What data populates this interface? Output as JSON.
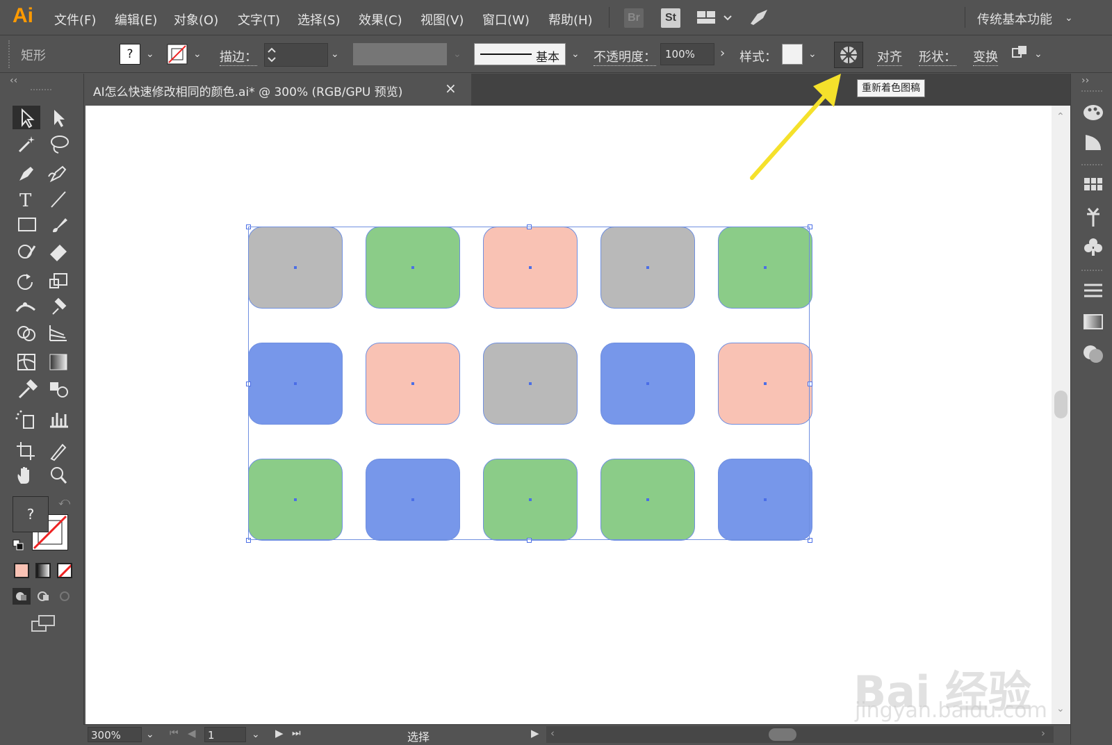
{
  "app": {
    "logo": "Ai"
  },
  "menu": [
    "文件(F)",
    "编辑(E)",
    "对象(O)",
    "文字(T)",
    "选择(S)",
    "效果(C)",
    "视图(V)",
    "窗口(W)",
    "帮助(H)"
  ],
  "menubar_right": {
    "br_label": "Br",
    "st_label": "St",
    "workspace": "传统基本功能"
  },
  "controlbar": {
    "object_type": "矩形",
    "fill_swatch": "?",
    "stroke_label": "描边：",
    "stroke_profile": "基本",
    "opacity_label": "不透明度：",
    "opacity_value": "100%",
    "style_label": "样式：",
    "align_label": "对齐",
    "shape_label": "形状：",
    "transform_label": "变换",
    "recolor_tooltip": "重新着色图稿"
  },
  "document": {
    "tab_title": "AI怎么快速修改相同的颜色.ai* @ 300% (RGB/GPU 预览)",
    "close": "×"
  },
  "toolbar": {
    "fill_question": "?"
  },
  "statusbar": {
    "zoom": "300%",
    "page": "1",
    "tool": "选择"
  },
  "watermark": {
    "text": "Bai 经验",
    "url": "jingyan.baidu.com"
  },
  "colors": {
    "gray": "#b9b9b9",
    "green": "#8bcc88",
    "pink": "#f9c2b4",
    "blue": "#7797ea",
    "arrow": "#f5e12b"
  },
  "grid": [
    [
      "gray",
      "green",
      "pink",
      "gray",
      "green"
    ],
    [
      "blue",
      "pink",
      "gray",
      "blue",
      "pink"
    ],
    [
      "green",
      "blue",
      "green",
      "green",
      "blue"
    ]
  ]
}
